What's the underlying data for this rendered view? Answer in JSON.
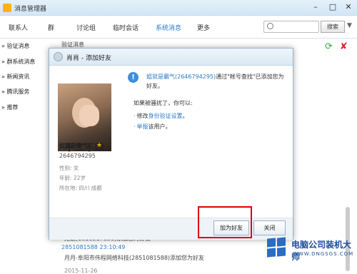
{
  "window": {
    "title": "消息管理器"
  },
  "nav": {
    "tabs": [
      "联系人",
      "群",
      "讨论组",
      "临时会话",
      "系统消息",
      "更多"
    ],
    "active_index": 4
  },
  "search": {
    "button": "搜索"
  },
  "sidebar": {
    "items": [
      "验证消息",
      "群系统消息",
      "新闻资讯",
      "腾讯服务",
      "推荐"
    ]
  },
  "main": {
    "top_msg": "验证消息",
    "messages": [
      "无误(1816317836)添加您为好友",
      "2851081588 23:10:49",
      "月月-阜阳市伟程网络科技(2851081588)添加您为好友",
      "2015-11-26"
    ]
  },
  "dialog": {
    "title": "肖肖 - 添加好友",
    "photo_text": "不二不四",
    "user": {
      "name": "姐就是霸气",
      "qq": "2646794295",
      "gender": "性别: 女",
      "age": "年龄: 22岁",
      "location": "所在地: 四川  成都"
    },
    "notice_name": "姐就是霸气(2646794295)",
    "notice_rest": "通过\"帐号查找\"已添加您为好友。",
    "prompt": "如果被骚扰了，你可以:",
    "opt1_pre": "修改",
    "opt1_link": "身份验证设置",
    "opt1_post": "。",
    "opt2_link": "举报",
    "opt2_post": "该用户。",
    "btn_add": "加为好友",
    "btn_close": "关闭"
  },
  "watermark": {
    "title": "电脑公司装机大师",
    "url": "WWW.DNGSGS.COM"
  }
}
